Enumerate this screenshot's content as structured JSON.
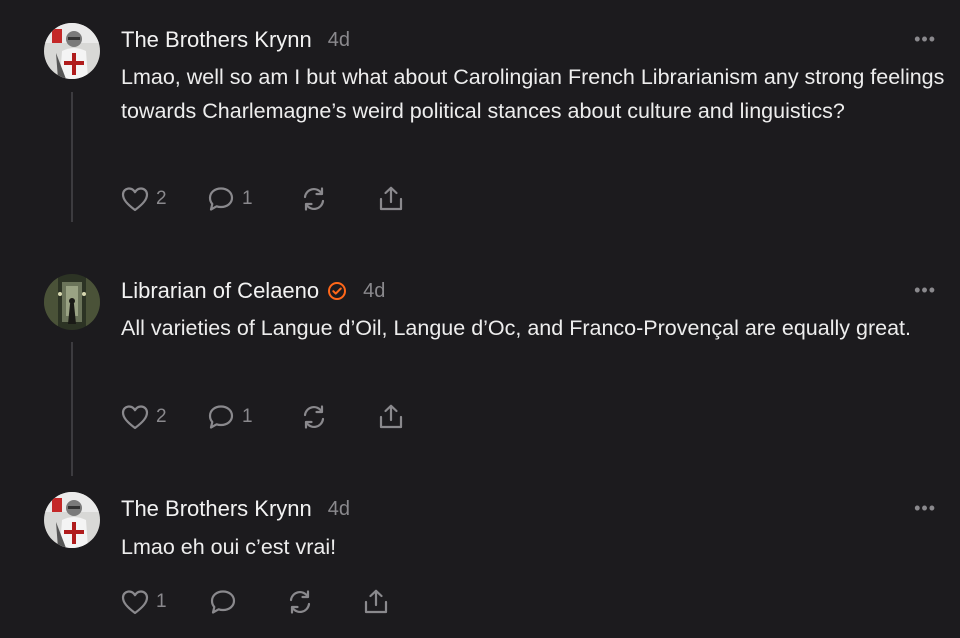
{
  "colors": {
    "background": "#1c1b1e",
    "text": "#ededed",
    "muted": "#8a898d",
    "verified": "#ff6719",
    "thread_line": "#3c3b3f"
  },
  "comments": [
    {
      "author": "The Brothers Krynn",
      "time": "4d",
      "avatar": "knight-avatar",
      "text": "Lmao, well so am I but what about Carolingian French Librarianism any strong feelings towards Charlemagne’s weird political stances about culture and linguistics?",
      "likes": "2",
      "replies": "1"
    },
    {
      "author": "Librarian of Celaeno",
      "verified": true,
      "time": "4d",
      "avatar": "library-corridor-avatar",
      "text": "All varieties of Langue d’Oil, Langue d’Oc, and Franco-Provençal are equally great.",
      "likes": "2",
      "replies": "1"
    },
    {
      "author": "The Brothers Krynn",
      "time": "4d",
      "avatar": "knight-avatar",
      "text": "Lmao eh oui c’est vrai!",
      "likes": "1",
      "replies": ""
    }
  ],
  "icons": {
    "like": "heart-icon",
    "reply": "comment-icon",
    "restack": "restack-icon",
    "share": "share-icon",
    "more": "more-options-icon",
    "verified": "verified-check-icon"
  },
  "more_label": "•••"
}
